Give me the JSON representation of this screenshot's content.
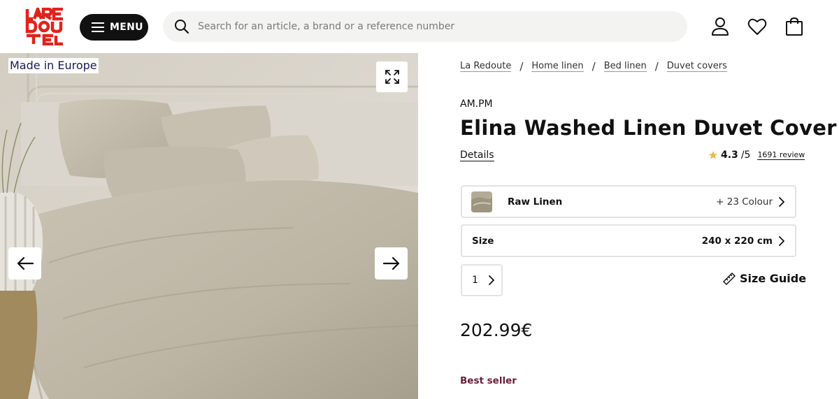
{
  "header": {
    "logo_text": "LA REDOUTE",
    "menu_label": "MENU",
    "search_placeholder": "Search for an article, a brand or a reference number",
    "icons": [
      "account-icon",
      "heart-icon",
      "bag-icon"
    ]
  },
  "gallery": {
    "badge": "Made in Europe",
    "icons": [
      "expand-icon",
      "arrow-left-icon",
      "arrow-right-icon"
    ]
  },
  "breadcrumb": [
    "La Redoute",
    "Home linen",
    "Bed linen",
    "Duvet covers"
  ],
  "breadcrumb_separator": "/",
  "product": {
    "brand": "AM.PM",
    "title": "Elina Washed Linen Duvet Cover",
    "details_link": "Details",
    "rating": {
      "score": "4.3",
      "max": "/5",
      "reviews": "1691 review"
    },
    "colour": {
      "name": "Raw Linen",
      "more": "+ 23 Colour"
    },
    "size": {
      "label": "Size",
      "value": "240 x 220 cm"
    },
    "quantity": "1",
    "size_guide": "Size Guide",
    "price": "202.99€",
    "badge": "Best seller"
  },
  "colors": {
    "logo_red": "#e2231a",
    "star": "#e8b84a",
    "badge": "#6b1e3a"
  }
}
